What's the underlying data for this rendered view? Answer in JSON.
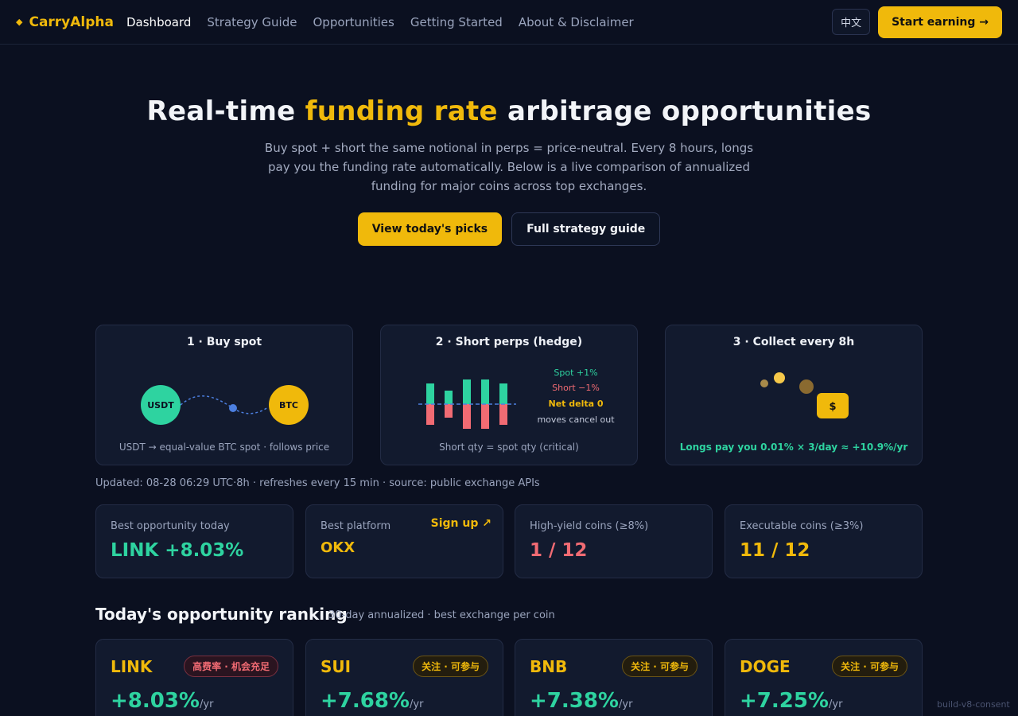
{
  "nav": {
    "brand": "CarryAlpha",
    "brand_icon": "diamond-icon",
    "links": [
      {
        "label": "Dashboard",
        "active": true
      },
      {
        "label": "Strategy Guide",
        "active": false
      },
      {
        "label": "Opportunities",
        "active": false
      },
      {
        "label": "Getting Started",
        "active": false
      },
      {
        "label": "About & Disclaimer",
        "active": false
      }
    ],
    "lang_label": "中文",
    "cta_label": "Start earning →"
  },
  "hero": {
    "title_pre": "Real-time ",
    "title_highlight": "funding rate",
    "title_post": " arbitrage opportunities",
    "subtitle": "Buy spot + short the same notional in perps = price-neutral. Every 8 hours, longs pay you the funding rate automatically. Below is a live comparison of annualized funding for major coins across top exchanges.",
    "primary_btn": "View today's picks",
    "secondary_btn": "Full strategy guide"
  },
  "steps": [
    {
      "title": "1 · Buy spot",
      "caption": "USDT → equal-value BTC spot · follows price",
      "coin_a": "USDT",
      "coin_b": "BTC"
    },
    {
      "title": "2 · Short perps (hedge)",
      "caption": "Short qty = spot qty (critical)",
      "legend": [
        "Spot +1%",
        "Short −1%",
        "Net delta 0",
        "moves cancel out"
      ]
    },
    {
      "title": "3 · Collect every 8h",
      "caption": "Longs pay you 0.01% × 3/day ≈ +10.9%/yr",
      "dollar": "$"
    }
  ],
  "updated": "Updated: 08-28 06:29 UTC·8h · refreshes every 15 min · source: public exchange APIs",
  "stats": [
    {
      "label": "Best opportunity today",
      "value": "LINK +8.03%",
      "color": "#2ed3a0"
    },
    {
      "label": "Best platform",
      "value": "OKX",
      "color": "#f0b90b",
      "link": "Sign up ↗"
    },
    {
      "label": "High-yield coins (≥8%)",
      "value": "1 / 12",
      "color": "#f16b73"
    },
    {
      "label": "Executable coins (≥3%)",
      "value": "11 / 12",
      "color": "#f0b90b"
    }
  ],
  "ranking": {
    "title": "Today's opportunity ranking",
    "subtitle": "30-day annualized · best exchange per coin",
    "coins": [
      {
        "name": "LINK",
        "badge": "高费率 · 机会充足",
        "badge_type": "hot",
        "rate": "+8.03%",
        "unit": "/yr"
      },
      {
        "name": "SUI",
        "badge": "关注 · 可参与",
        "badge_type": "watch",
        "rate": "+7.68%",
        "unit": "/yr"
      },
      {
        "name": "BNB",
        "badge": "关注 · 可参与",
        "badge_type": "watch",
        "rate": "+7.38%",
        "unit": "/yr"
      },
      {
        "name": "DOGE",
        "badge": "关注 · 可参与",
        "badge_type": "watch",
        "rate": "+7.25%",
        "unit": "/yr"
      }
    ]
  },
  "build": "build-v8-consent"
}
